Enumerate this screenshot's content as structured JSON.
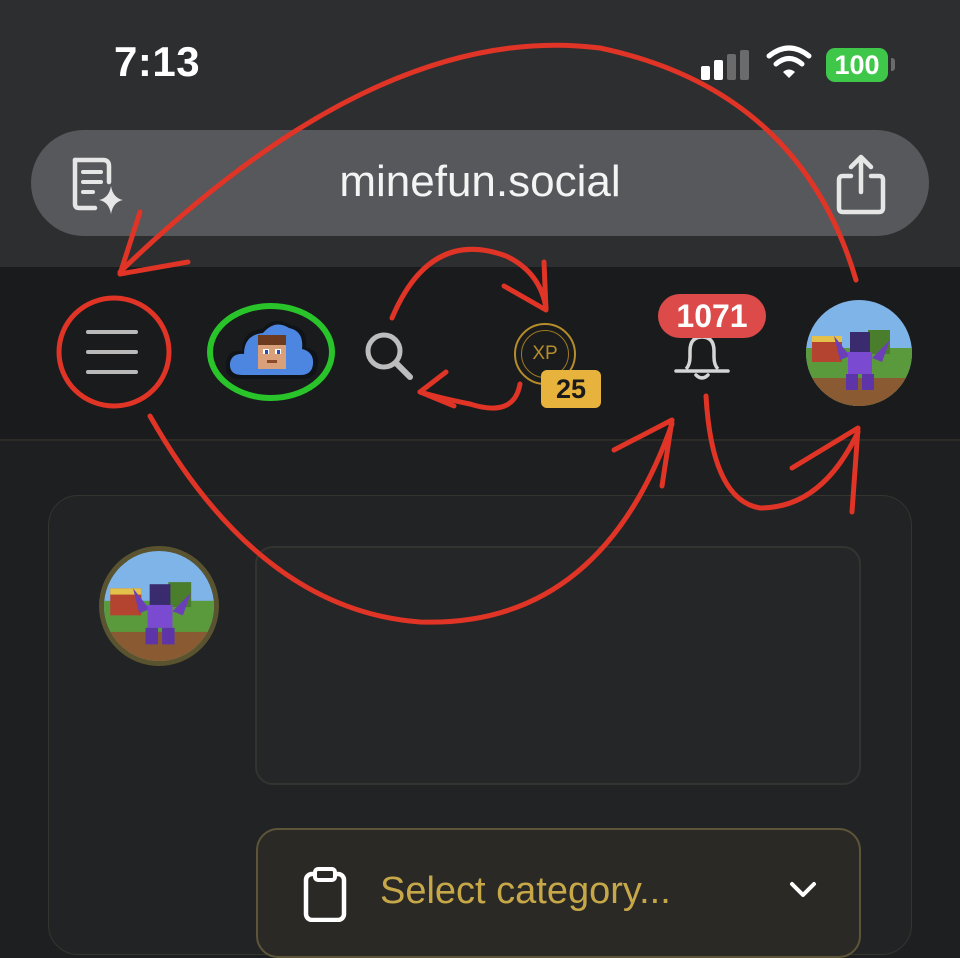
{
  "status_bar": {
    "time": "7:13",
    "battery": "100",
    "signal_bars_active": 2,
    "signal_bars_total": 4
  },
  "browser": {
    "url": "minefun.social",
    "left_icon": "reader-sparkle-icon",
    "right_icon": "share-icon"
  },
  "header": {
    "menu_icon": "hamburger-icon",
    "logo_icon": "cloud-logo-icon",
    "search_icon": "search-icon",
    "xp": {
      "coin_label": "XP",
      "level": "25"
    },
    "notifications": {
      "count": "1071",
      "icon": "bell-icon"
    },
    "avatar_icon": "user-avatar"
  },
  "composer": {
    "avatar_icon": "user-avatar",
    "textarea_placeholder": "",
    "category": {
      "selected": "Select category...",
      "icon": "clipboard-icon",
      "chevron": "chevron-down-icon"
    }
  },
  "colors": {
    "annotation_red": "#e03426",
    "annotation_green": "#28c42a",
    "accent_gold": "#c7a849",
    "badge_red": "#dc4a4a",
    "xp_badge": "#e8b33c",
    "battery_green": "#3fc74a"
  }
}
